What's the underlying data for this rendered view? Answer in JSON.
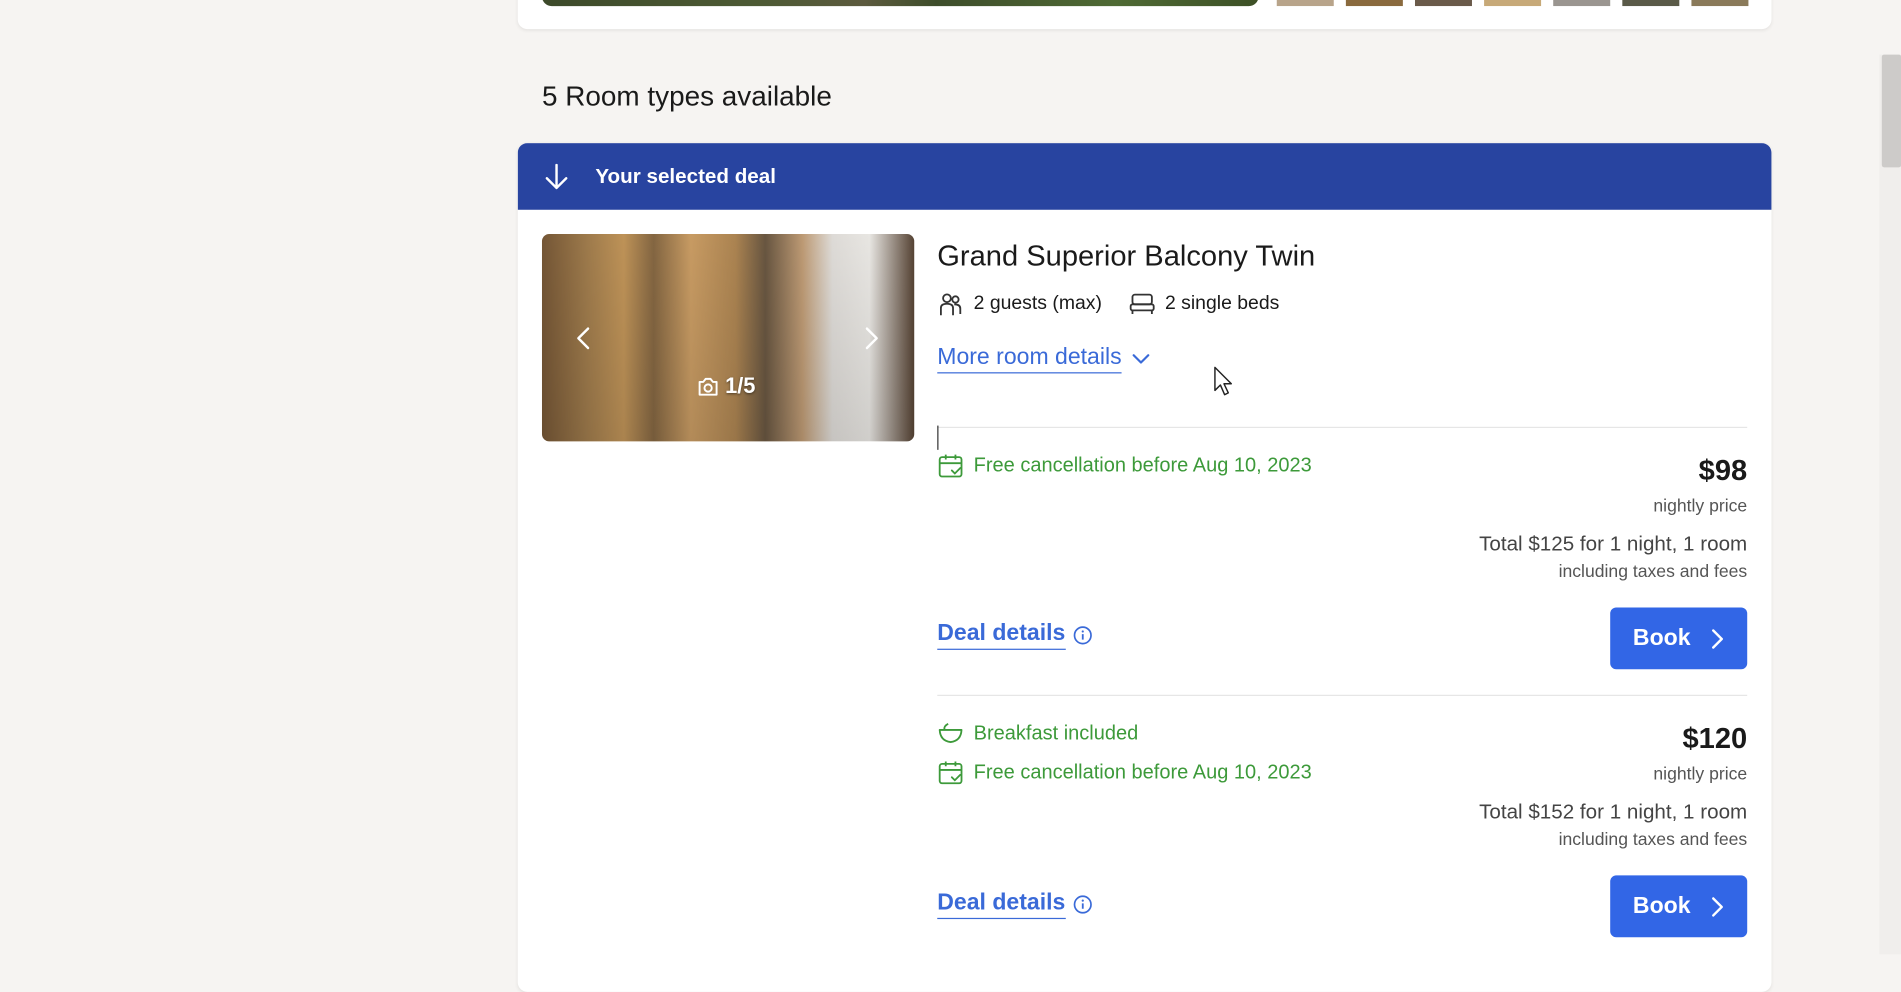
{
  "section": {
    "title": "5 Room types available"
  },
  "banner": {
    "label": "Your selected deal",
    "color": "#2844a0"
  },
  "room": {
    "name": "Grand Superior Balcony Twin",
    "guests": "2 guests (max)",
    "beds": "2 single beds",
    "more_details": "More room details",
    "photo_counter": "1/5"
  },
  "deals": [
    {
      "perks": [
        "Free cancellation before Aug 10, 2023"
      ],
      "price": "$98",
      "price_caption": "nightly price",
      "total": "Total $125 for 1 night, 1 room",
      "total_caption": "including taxes and fees",
      "details_label": "Deal details",
      "book_label": "Book"
    },
    {
      "perks": [
        "Breakfast included",
        "Free cancellation before Aug 10, 2023"
      ],
      "price": "$120",
      "price_caption": "nightly price",
      "total": "Total $152 for 1 night, 1 room",
      "total_caption": "including taxes and fees",
      "details_label": "Deal details",
      "book_label": "Book"
    }
  ],
  "colors": {
    "accent": "#3266e6",
    "link": "#3a6ad8",
    "perk": "#3d9a3a"
  },
  "icons": [
    "arrow-down-icon",
    "guests-icon",
    "bed-icon",
    "chevron-down-icon",
    "calendar-check-icon",
    "breakfast-bowl-icon",
    "info-icon",
    "chevron-right-icon",
    "chevron-left-icon",
    "camera-icon",
    "mouse-cursor-icon"
  ]
}
